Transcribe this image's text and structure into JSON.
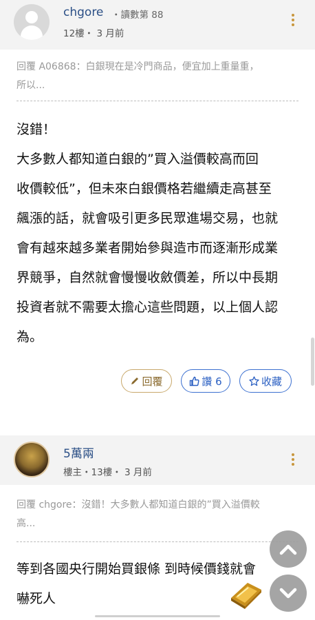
{
  "post1": {
    "username": "chgore",
    "read_count": "・讀數第 88",
    "floor_time": "12樓・ 3 月前",
    "reply_quote_line1": "回覆 A06868：白銀現在是冷門商品，便宜加上重量重，",
    "reply_quote_line2": "所以...",
    "content_lines": [
      "沒錯！",
      "大多數人都知道白銀的”買入溢價較高而回",
      "收價較低”，但未來白銀價格若繼續走高甚至",
      "飆漲的話，就會吸引更多民眾進場交易，也就",
      "會有越來越多業者開始參與造市而逐漸形成業",
      "界競爭，自然就會慢慢收斂價差，所以中長期",
      "投資者就不需要太擔心這些問題，以上個人認",
      "為。"
    ],
    "reply_button": "回覆",
    "like_button": "讚 6",
    "favorite_button": "收藏"
  },
  "post2": {
    "username": "5萬兩",
    "floor_time": "樓主・13樓・ 3 月前",
    "reply_quote_line1": "回覆 chgore：沒錯！大多數人都知道白銀的”買入溢價較",
    "reply_quote_line2": "高...",
    "content_lines": [
      "等到各國央行開始買銀條 到時候價錢就會",
      "嚇死人"
    ]
  },
  "icons": {
    "avatar_default": "default-user-avatar",
    "avatar_post2": "buddha-statue-avatar",
    "kebab": "more-vertical-icon",
    "reply": "pencil-icon",
    "like": "thumbs-up-icon",
    "favorite": "star-icon",
    "scroll_up": "chevron-up-icon",
    "scroll_down": "chevron-down-icon",
    "emoji": "gold-bar-emoji"
  },
  "colors": {
    "username": "#2b4f86",
    "accent_gold": "#c8963c",
    "accent_blue": "#2a5fc2",
    "header_bg": "#f3f3f3"
  }
}
